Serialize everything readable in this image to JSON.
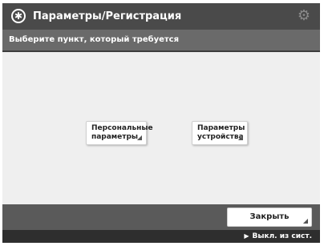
{
  "header": {
    "title": "Параметры/Регистрация",
    "logo_icon": "settings-registration-icon",
    "gear_icon": "gear-icon"
  },
  "subbar": {
    "message": "Выберите пункт, который требуется"
  },
  "options": [
    {
      "label_line1": "Персональные",
      "label_line2": "параметры"
    },
    {
      "label_line1": "Параметры",
      "label_line2": "устройства"
    }
  ],
  "footer": {
    "close_label": "Закрыть"
  },
  "status": {
    "text": "Выкл. из сист."
  }
}
